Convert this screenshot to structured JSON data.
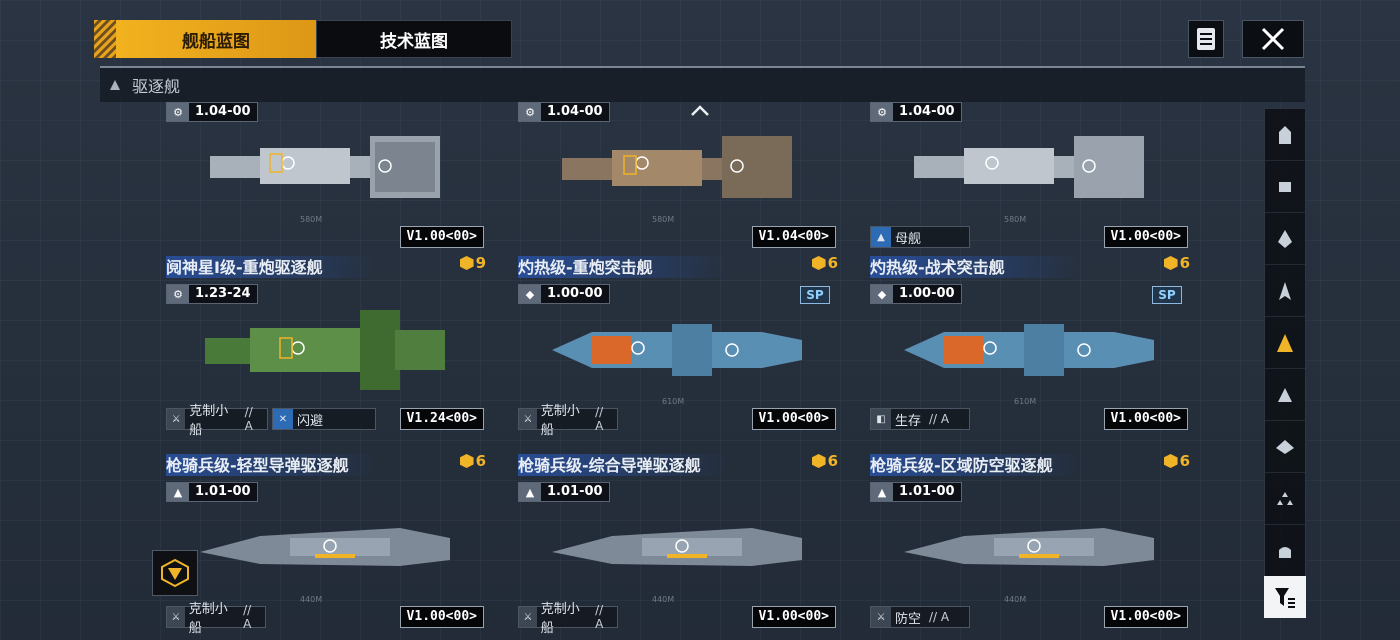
{
  "tabs": {
    "ship_blueprint": "舰船蓝图",
    "tech_blueprint": "技术蓝图"
  },
  "category": {
    "label": "驱逐舰"
  },
  "cards": [
    {
      "name": "",
      "cost": "",
      "version_prefix": "1.04",
      "version_suffix": "00",
      "version": "V1.00<00>",
      "tag1": "",
      "tag1_grade": "",
      "tag2": "",
      "length": "580M"
    },
    {
      "name": "",
      "cost": "",
      "version_prefix": "1.04",
      "version_suffix": "00",
      "version": "V1.04<00>",
      "tag1": "",
      "tag1_grade": "",
      "tag2": "",
      "length": "580M"
    },
    {
      "name": "",
      "cost": "",
      "version_prefix": "1.04",
      "version_suffix": "00",
      "version": "V1.00<00>",
      "tag1": "母舰",
      "tag1_grade": "",
      "tag2": "",
      "length": "580M"
    },
    {
      "name": "阋神星I级-重炮驱逐舰",
      "cost": "9",
      "version_prefix": "1.23",
      "version_suffix": "24",
      "version": "V1.24<00>",
      "tag1": "克制小船",
      "tag1_grade": "// A",
      "tag2": "闪避",
      "length": "",
      "sp": ""
    },
    {
      "name": "灼热级-重炮突击舰",
      "cost": "6",
      "version_prefix": "1.00",
      "version_suffix": "00",
      "version": "V1.00<00>",
      "tag1": "克制小船",
      "tag1_grade": "// A",
      "tag2": "",
      "length": "610M",
      "sp": "SP"
    },
    {
      "name": "灼热级-战术突击舰",
      "cost": "6",
      "version_prefix": "1.00",
      "version_suffix": "00",
      "version": "V1.00<00>",
      "tag1": "生存",
      "tag1_grade": "// A",
      "tag2": "",
      "length": "610M",
      "sp": "SP"
    },
    {
      "name": "枪骑兵级-轻型导弹驱逐舰",
      "cost": "6",
      "version_prefix": "1.01",
      "version_suffix": "00",
      "version": "V1.00<00>",
      "tag1": "克制小船",
      "tag1_grade": "// A",
      "tag2": "",
      "length": "440M"
    },
    {
      "name": "枪骑兵级-综合导弹驱逐舰",
      "cost": "6",
      "version_prefix": "1.01",
      "version_suffix": "00",
      "version": "V1.00<00>",
      "tag1": "克制小船",
      "tag1_grade": "// A",
      "tag2": "",
      "length": "440M"
    },
    {
      "name": "枪骑兵级-区域防空驱逐舰",
      "cost": "6",
      "version_prefix": "1.01",
      "version_suffix": "00",
      "version": "V1.00<00>",
      "tag1": "防空",
      "tag1_grade": "// A",
      "tag2": "",
      "length": "440M"
    }
  ],
  "colors": {
    "accent": "#f0b428",
    "card_title_blue": "#2850a0",
    "ship_green": "#4a7a3a",
    "ship_blue": "#5a8fb4",
    "ship_orange": "#d9682a",
    "ship_grey": "#a8b0ba"
  },
  "sidebar_icons": [
    "battleship-icon",
    "carrier-icon",
    "cruiser-icon",
    "destroyer-icon",
    "frigate-icon",
    "corvette-icon",
    "fighter-icon",
    "aux-icon",
    "shield-icon"
  ]
}
